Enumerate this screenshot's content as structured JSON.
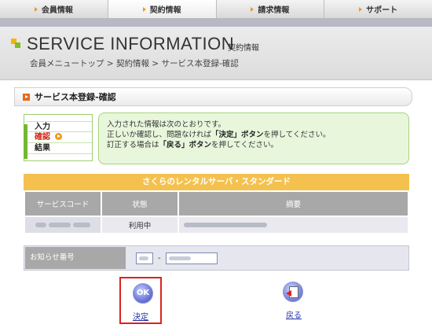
{
  "tabs": [
    {
      "label": "会員情報",
      "active": false
    },
    {
      "label": "契約情報",
      "active": true
    },
    {
      "label": "請求情報",
      "active": false
    },
    {
      "label": "サポート",
      "active": false
    }
  ],
  "header": {
    "title": "SERVICE INFORMATION",
    "subtitle": "契約情報",
    "breadcrumb": "会員メニュートップ > 契約情報 > サービス本登録-確認"
  },
  "section": {
    "title": "サービス本登録-確認"
  },
  "steps": [
    {
      "label": "入力",
      "current": false
    },
    {
      "label": "確認",
      "current": true
    },
    {
      "label": "結果",
      "current": false
    }
  ],
  "info": {
    "line1": "入力された情報は次のとおりです。",
    "line2_pre": "正しいか確認し、問題なければ",
    "line2_strong": "「決定」ボタン",
    "line2_post": "を押してください。",
    "line3_pre": "訂正する場合は",
    "line3_strong": "「戻る」ボタン",
    "line3_post": "を押してください。"
  },
  "service": {
    "name": "さくらのレンタルサーバ・スタンダード",
    "columns": [
      "サービスコード",
      "状態",
      "摘要"
    ],
    "rows": [
      {
        "code": "",
        "status": "利用中",
        "summary": ""
      }
    ]
  },
  "notice": {
    "label": "お知らせ番号",
    "part1": "",
    "separator": "-",
    "part2": ""
  },
  "buttons": {
    "ok_icon_text": "OK",
    "ok_label": "決定",
    "back_label": "戻る"
  },
  "colors": {
    "accent_orange": "#f5c14e",
    "highlight_red": "#d9251c",
    "info_green": "#e8f6dc"
  }
}
